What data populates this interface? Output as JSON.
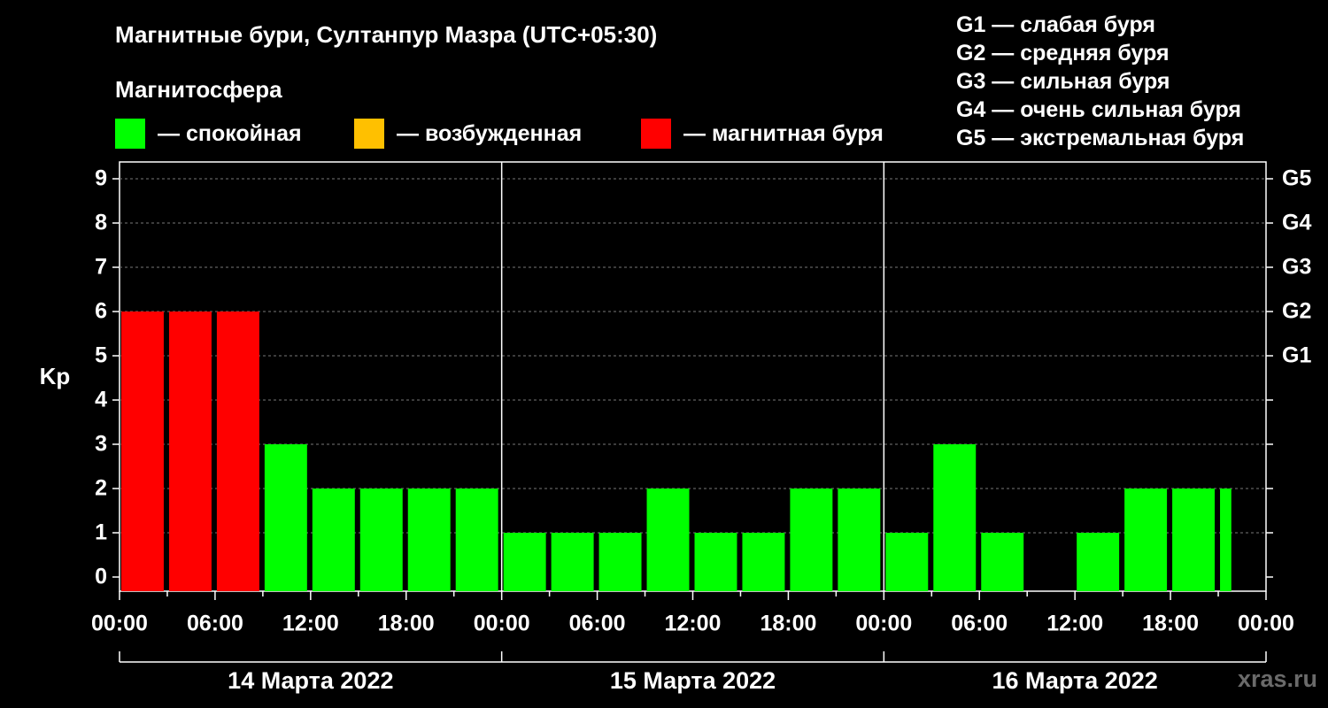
{
  "title": "Магнитные бури, Султанпур Мазра (UTC+05:30)",
  "legend": {
    "heading": "Магнитосфера",
    "items": [
      {
        "label": "— спокойная",
        "color": "#00ff00"
      },
      {
        "label": "— возбужденная",
        "color": "#ffc000"
      },
      {
        "label": "— магнитная буря",
        "color": "#ff0000"
      }
    ]
  },
  "g_legend": [
    "G1 — слабая буря",
    "G2 — средняя буря",
    "G3 — сильная буря",
    "G4 — очень сильная буря",
    "G5 — экстремальная буря"
  ],
  "watermark": "xras.ru",
  "chart_data": {
    "type": "bar",
    "ylabel": "Kp",
    "ylim": [
      0,
      9
    ],
    "yticks": [
      "0",
      "1",
      "2",
      "3",
      "4",
      "5",
      "6",
      "7",
      "8",
      "9"
    ],
    "right_axis": [
      {
        "kp": 5,
        "label": "G1"
      },
      {
        "kp": 6,
        "label": "G2"
      },
      {
        "kp": 7,
        "label": "G3"
      },
      {
        "kp": 8,
        "label": "G4"
      },
      {
        "kp": 9,
        "label": "G5"
      }
    ],
    "xtick_labels": [
      "00:00",
      "06:00",
      "12:00",
      "18:00",
      "00:00",
      "06:00",
      "12:00",
      "18:00",
      "00:00",
      "06:00",
      "12:00",
      "18:00",
      "00:00"
    ],
    "days": [
      "14 Марта 2022",
      "15 Марта 2022",
      "16 Марта 2022"
    ],
    "interval_hours": 3,
    "values": [
      6,
      6,
      6,
      3,
      2,
      2,
      2,
      2,
      1,
      1,
      1,
      2,
      1,
      1,
      2,
      2,
      1,
      3,
      1,
      0,
      1,
      2,
      2,
      2
    ],
    "colors": [
      "#ff0000",
      "#ff0000",
      "#ff0000",
      "#00ff00",
      "#00ff00",
      "#00ff00",
      "#00ff00",
      "#00ff00",
      "#00ff00",
      "#00ff00",
      "#00ff00",
      "#00ff00",
      "#00ff00",
      "#00ff00",
      "#00ff00",
      "#00ff00",
      "#00ff00",
      "#00ff00",
      "#00ff00",
      "#00ff00",
      "#00ff00",
      "#00ff00",
      "#00ff00",
      "#00ff00"
    ],
    "grid": "dashed horizontal"
  }
}
